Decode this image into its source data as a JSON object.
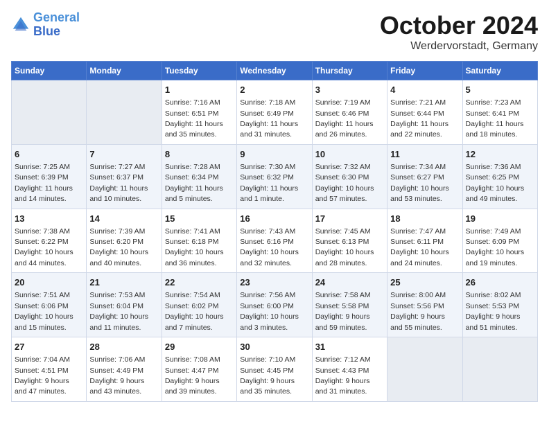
{
  "logo": {
    "line1": "General",
    "line2": "Blue"
  },
  "title": "October 2024",
  "subtitle": "Werdervorstadt, Germany",
  "header": {
    "accent_color": "#3a6cc8"
  },
  "days_of_week": [
    "Sunday",
    "Monday",
    "Tuesday",
    "Wednesday",
    "Thursday",
    "Friday",
    "Saturday"
  ],
  "weeks": [
    {
      "days": [
        {
          "num": "",
          "info": "",
          "empty": true
        },
        {
          "num": "",
          "info": "",
          "empty": true
        },
        {
          "num": "1",
          "info": "Sunrise: 7:16 AM\nSunset: 6:51 PM\nDaylight: 11 hours\nand 35 minutes."
        },
        {
          "num": "2",
          "info": "Sunrise: 7:18 AM\nSunset: 6:49 PM\nDaylight: 11 hours\nand 31 minutes."
        },
        {
          "num": "3",
          "info": "Sunrise: 7:19 AM\nSunset: 6:46 PM\nDaylight: 11 hours\nand 26 minutes."
        },
        {
          "num": "4",
          "info": "Sunrise: 7:21 AM\nSunset: 6:44 PM\nDaylight: 11 hours\nand 22 minutes."
        },
        {
          "num": "5",
          "info": "Sunrise: 7:23 AM\nSunset: 6:41 PM\nDaylight: 11 hours\nand 18 minutes."
        }
      ]
    },
    {
      "days": [
        {
          "num": "6",
          "info": "Sunrise: 7:25 AM\nSunset: 6:39 PM\nDaylight: 11 hours\nand 14 minutes."
        },
        {
          "num": "7",
          "info": "Sunrise: 7:27 AM\nSunset: 6:37 PM\nDaylight: 11 hours\nand 10 minutes."
        },
        {
          "num": "8",
          "info": "Sunrise: 7:28 AM\nSunset: 6:34 PM\nDaylight: 11 hours\nand 5 minutes."
        },
        {
          "num": "9",
          "info": "Sunrise: 7:30 AM\nSunset: 6:32 PM\nDaylight: 11 hours\nand 1 minute."
        },
        {
          "num": "10",
          "info": "Sunrise: 7:32 AM\nSunset: 6:30 PM\nDaylight: 10 hours\nand 57 minutes."
        },
        {
          "num": "11",
          "info": "Sunrise: 7:34 AM\nSunset: 6:27 PM\nDaylight: 10 hours\nand 53 minutes."
        },
        {
          "num": "12",
          "info": "Sunrise: 7:36 AM\nSunset: 6:25 PM\nDaylight: 10 hours\nand 49 minutes."
        }
      ]
    },
    {
      "days": [
        {
          "num": "13",
          "info": "Sunrise: 7:38 AM\nSunset: 6:22 PM\nDaylight: 10 hours\nand 44 minutes."
        },
        {
          "num": "14",
          "info": "Sunrise: 7:39 AM\nSunset: 6:20 PM\nDaylight: 10 hours\nand 40 minutes."
        },
        {
          "num": "15",
          "info": "Sunrise: 7:41 AM\nSunset: 6:18 PM\nDaylight: 10 hours\nand 36 minutes."
        },
        {
          "num": "16",
          "info": "Sunrise: 7:43 AM\nSunset: 6:16 PM\nDaylight: 10 hours\nand 32 minutes."
        },
        {
          "num": "17",
          "info": "Sunrise: 7:45 AM\nSunset: 6:13 PM\nDaylight: 10 hours\nand 28 minutes."
        },
        {
          "num": "18",
          "info": "Sunrise: 7:47 AM\nSunset: 6:11 PM\nDaylight: 10 hours\nand 24 minutes."
        },
        {
          "num": "19",
          "info": "Sunrise: 7:49 AM\nSunset: 6:09 PM\nDaylight: 10 hours\nand 19 minutes."
        }
      ]
    },
    {
      "days": [
        {
          "num": "20",
          "info": "Sunrise: 7:51 AM\nSunset: 6:06 PM\nDaylight: 10 hours\nand 15 minutes."
        },
        {
          "num": "21",
          "info": "Sunrise: 7:53 AM\nSunset: 6:04 PM\nDaylight: 10 hours\nand 11 minutes."
        },
        {
          "num": "22",
          "info": "Sunrise: 7:54 AM\nSunset: 6:02 PM\nDaylight: 10 hours\nand 7 minutes."
        },
        {
          "num": "23",
          "info": "Sunrise: 7:56 AM\nSunset: 6:00 PM\nDaylight: 10 hours\nand 3 minutes."
        },
        {
          "num": "24",
          "info": "Sunrise: 7:58 AM\nSunset: 5:58 PM\nDaylight: 9 hours\nand 59 minutes."
        },
        {
          "num": "25",
          "info": "Sunrise: 8:00 AM\nSunset: 5:56 PM\nDaylight: 9 hours\nand 55 minutes."
        },
        {
          "num": "26",
          "info": "Sunrise: 8:02 AM\nSunset: 5:53 PM\nDaylight: 9 hours\nand 51 minutes."
        }
      ]
    },
    {
      "days": [
        {
          "num": "27",
          "info": "Sunrise: 7:04 AM\nSunset: 4:51 PM\nDaylight: 9 hours\nand 47 minutes."
        },
        {
          "num": "28",
          "info": "Sunrise: 7:06 AM\nSunset: 4:49 PM\nDaylight: 9 hours\nand 43 minutes."
        },
        {
          "num": "29",
          "info": "Sunrise: 7:08 AM\nSunset: 4:47 PM\nDaylight: 9 hours\nand 39 minutes."
        },
        {
          "num": "30",
          "info": "Sunrise: 7:10 AM\nSunset: 4:45 PM\nDaylight: 9 hours\nand 35 minutes."
        },
        {
          "num": "31",
          "info": "Sunrise: 7:12 AM\nSunset: 4:43 PM\nDaylight: 9 hours\nand 31 minutes."
        },
        {
          "num": "",
          "info": "",
          "empty": true
        },
        {
          "num": "",
          "info": "",
          "empty": true
        }
      ]
    }
  ]
}
